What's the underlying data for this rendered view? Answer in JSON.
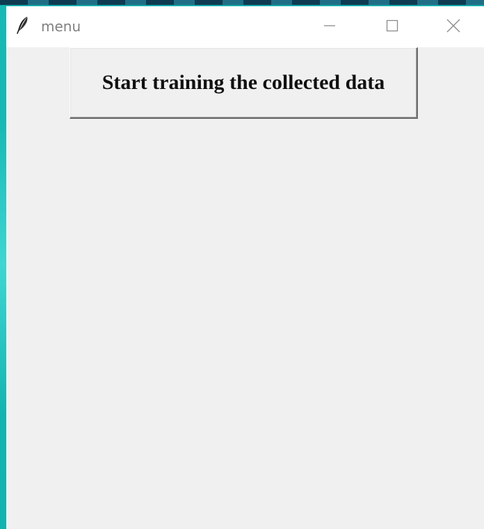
{
  "window": {
    "title": "menu",
    "icon": "feather-icon",
    "controls": {
      "minimize": "minimize-icon",
      "maximize": "maximize-icon",
      "close": "close-icon"
    }
  },
  "main": {
    "train_button_label": "Start training the collected data"
  },
  "colors": {
    "desktop": "#15b8b4",
    "titlebar": "#ffffff",
    "title_text": "#808080",
    "client_area": "#f0f0f0",
    "button_text": "#111111"
  }
}
